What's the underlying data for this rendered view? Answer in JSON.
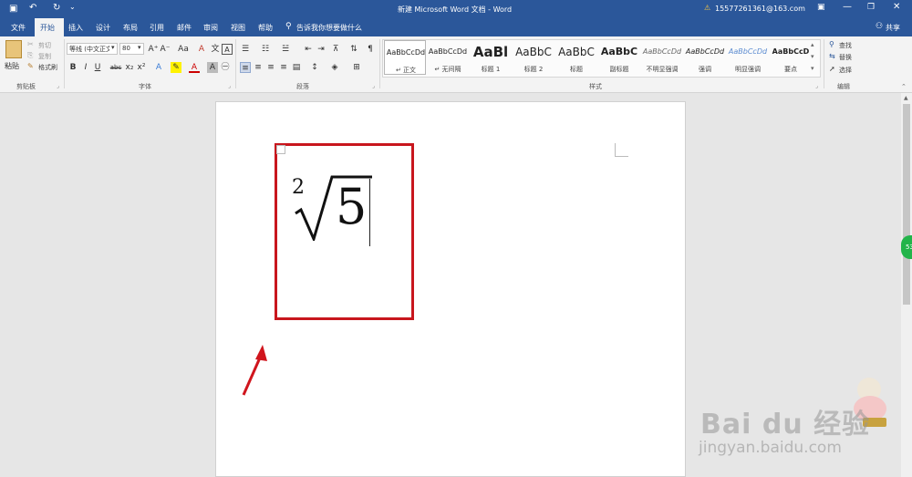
{
  "titlebar": {
    "doc_title": "新建 Microsoft Word 文档 - Word",
    "account": "15577261361@163.com",
    "share": "共享"
  },
  "tabs": [
    "文件",
    "开始",
    "插入",
    "设计",
    "布局",
    "引用",
    "邮件",
    "审阅",
    "视图",
    "帮助"
  ],
  "tell_me": "告诉我你想要做什么",
  "clipboard": {
    "paste": "粘贴",
    "cut": "剪切",
    "copy": "复制",
    "format_painter": "格式刷",
    "label": "剪贴板"
  },
  "font": {
    "name": "等线 (中文正文",
    "size": "80",
    "label": "字体",
    "bold": "B",
    "italic": "I",
    "underline": "U",
    "strike": "abc",
    "sub": "x₂",
    "sup": "x²",
    "grow": "A⁺",
    "shrink": "A⁻",
    "case": "Aa",
    "clear": "A",
    "phonetic": "文",
    "border": "A"
  },
  "paragraph": {
    "label": "段落"
  },
  "styles": {
    "label": "样式",
    "items": [
      {
        "sample": "AaBbCcDd",
        "name": "↵ 正文"
      },
      {
        "sample": "AaBbCcDd",
        "name": "↵ 无间隔"
      },
      {
        "sample": "AaBl",
        "name": "标题 1"
      },
      {
        "sample": "AaBbC",
        "name": "标题 2"
      },
      {
        "sample": "AaBbC",
        "name": "标题"
      },
      {
        "sample": "AaBbC",
        "name": "副标题"
      },
      {
        "sample": "AaBbCcDd",
        "name": "不明显强调"
      },
      {
        "sample": "AaBbCcDd",
        "name": "强调"
      },
      {
        "sample": "AaBbCcDd",
        "name": "明显强调"
      },
      {
        "sample": "AaBbCcD",
        "name": "要点"
      }
    ]
  },
  "editing": {
    "find": "查找",
    "replace": "替换",
    "select": "选择",
    "label": "编辑"
  },
  "document": {
    "root_index": "2",
    "radicand": "5"
  },
  "watermark": {
    "brand": "Bai du 经验",
    "url": "jingyan.baidu.com"
  },
  "side_badge": "53",
  "colors": {
    "accent": "#2b579a",
    "highlight_box": "#c8161d",
    "arrow": "#d0151d"
  }
}
